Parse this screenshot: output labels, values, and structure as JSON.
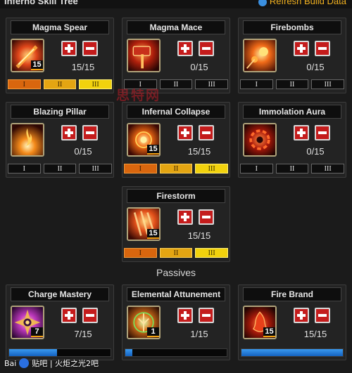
{
  "header": {
    "title": "Inferno Skill Tree",
    "refresh_label": "Refresh Build Data"
  },
  "skills": [
    {
      "name": "Magma Spear",
      "rank": "15/15",
      "badge": "15",
      "tiers": [
        "I",
        "II",
        "III"
      ],
      "tiers_unlocked": 3,
      "icon": "magma-spear-icon"
    },
    {
      "name": "Magma Mace",
      "rank": "0/15",
      "badge": "",
      "tiers": [
        "I",
        "II",
        "III"
      ],
      "tiers_unlocked": 0,
      "icon": "magma-mace-icon"
    },
    {
      "name": "Firebombs",
      "rank": "0/15",
      "badge": "",
      "tiers": [
        "I",
        "II",
        "III"
      ],
      "tiers_unlocked": 0,
      "icon": "firebombs-icon"
    },
    {
      "name": "Blazing Pillar",
      "rank": "0/15",
      "badge": "",
      "tiers": [
        "I",
        "II",
        "III"
      ],
      "tiers_unlocked": 0,
      "icon": "blazing-pillar-icon"
    },
    {
      "name": "Infernal Collapse",
      "rank": "15/15",
      "badge": "15",
      "tiers": [
        "I",
        "II",
        "III"
      ],
      "tiers_unlocked": 3,
      "icon": "infernal-collapse-icon"
    },
    {
      "name": "Immolation Aura",
      "rank": "0/15",
      "badge": "",
      "tiers": [
        "I",
        "II",
        "III"
      ],
      "tiers_unlocked": 0,
      "icon": "immolation-aura-icon"
    },
    {
      "name": "Firestorm",
      "rank": "15/15",
      "badge": "15",
      "tiers": [
        "I",
        "II",
        "III"
      ],
      "tiers_unlocked": 3,
      "icon": "firestorm-icon"
    }
  ],
  "passives_label": "Passives",
  "passives": [
    {
      "name": "Charge Mastery",
      "rank": "7/15",
      "badge": "7",
      "progress": 0.47,
      "icon": "charge-mastery-icon"
    },
    {
      "name": "Elemental Attunement",
      "rank": "1/15",
      "badge": "1",
      "progress": 0.07,
      "icon": "elemental-attunement-icon"
    },
    {
      "name": "Fire Brand",
      "rank": "15/15",
      "badge": "15",
      "progress": 1.0,
      "icon": "fire-brand-icon"
    }
  ],
  "overlay": {
    "watermark": "思特网",
    "footer_brand": "Bai",
    "footer_text": "贴吧 | 火炬之光2吧"
  },
  "colors": {
    "plus_minus_button": "#c41c1c",
    "tier_1": "#d9660e",
    "tier_2": "#e4a512",
    "tier_3": "#f2d20d",
    "passive_bar": "#1e7fe0",
    "refresh_link": "#f0b020"
  }
}
